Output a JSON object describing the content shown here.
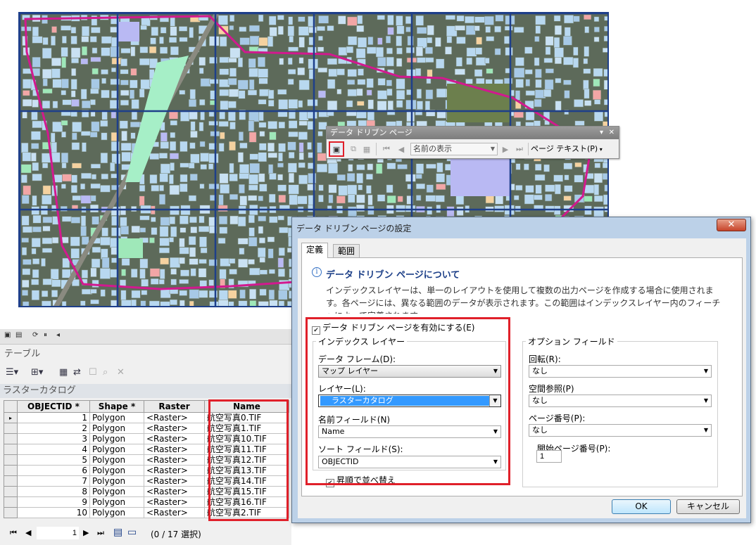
{
  "toolbar": {
    "title": "データ ドリブン ページ",
    "page_name_select": "名前の表示",
    "page_text_label": "ページ テキスト(P)",
    "icons": [
      "setup-icon",
      "export-icon",
      "table-icon",
      "first-page-icon",
      "previous-page-icon",
      "next-page-icon",
      "last-page-icon"
    ]
  },
  "table_panel": {
    "title": "テーブル",
    "layer_name": "ラスターカタログ",
    "columns": [
      "OBJECTID *",
      "Shape *",
      "Raster",
      "Name"
    ],
    "rows": [
      {
        "id": "1",
        "shape": "Polygon",
        "raster": "<Raster>",
        "name": "航空写真0.TIF"
      },
      {
        "id": "2",
        "shape": "Polygon",
        "raster": "<Raster>",
        "name": "航空写真1.TIF"
      },
      {
        "id": "3",
        "shape": "Polygon",
        "raster": "<Raster>",
        "name": "航空写真10.TIF"
      },
      {
        "id": "4",
        "shape": "Polygon",
        "raster": "<Raster>",
        "name": "航空写真11.TIF"
      },
      {
        "id": "5",
        "shape": "Polygon",
        "raster": "<Raster>",
        "name": "航空写真12.TIF"
      },
      {
        "id": "6",
        "shape": "Polygon",
        "raster": "<Raster>",
        "name": "航空写真13.TIF"
      },
      {
        "id": "7",
        "shape": "Polygon",
        "raster": "<Raster>",
        "name": "航空写真14.TIF"
      },
      {
        "id": "8",
        "shape": "Polygon",
        "raster": "<Raster>",
        "name": "航空写真15.TIF"
      },
      {
        "id": "9",
        "shape": "Polygon",
        "raster": "<Raster>",
        "name": "航空写真16.TIF"
      },
      {
        "id": "10",
        "shape": "Polygon",
        "raster": "<Raster>",
        "name": "航空写真2.TIF"
      }
    ],
    "pager": {
      "current_page": "1",
      "selection": "(0 / 17 選択)"
    }
  },
  "dialog": {
    "title": "データ ドリブン ページの設定",
    "close_label": "✕",
    "tabs": [
      "定義",
      "範囲"
    ],
    "about_heading": "データ ドリブン ページについて",
    "about_text": "インデックスレイヤーは、単一のレイアウトを使用して複数の出力ページを作成する場合に使用されます。各ページには、異なる範囲のデータが表示されます。この範囲はインデックスレイヤー内のフィーチャによって定義されます。",
    "enable_label": "データ ドリブン ページを有効にする(E)",
    "index_group": "インデックス レイヤー",
    "data_frame_label": "データ フレーム(D):",
    "data_frame_value": "マップ レイヤー",
    "layer_label": "レイヤー(L):",
    "layer_value": "ラスターカタログ",
    "name_field_label": "名前フィールド(N)",
    "name_field_value": "Name",
    "sort_field_label": "ソート フィールド(S):",
    "sort_field_value": "OBJECTID",
    "ascending_label": "昇順で並べ替え",
    "options_group": "オプション フィールド",
    "rotation_label": "回転(R):",
    "rotation_value": "なし",
    "spatial_ref_label": "空間参照(P)",
    "spatial_ref_value": "なし",
    "page_number_label": "ページ番号(P):",
    "page_number_value": "なし",
    "start_page_label": "開始ページ番号(P):",
    "start_page_value": "1",
    "ok_label": "OK",
    "cancel_label": "キャンセル"
  },
  "colors": {
    "accent_red": "#e0202a",
    "grid_blue": "#1e3f8a",
    "boundary_magenta": "#d2198f",
    "selection_blue": "#3399ff"
  }
}
